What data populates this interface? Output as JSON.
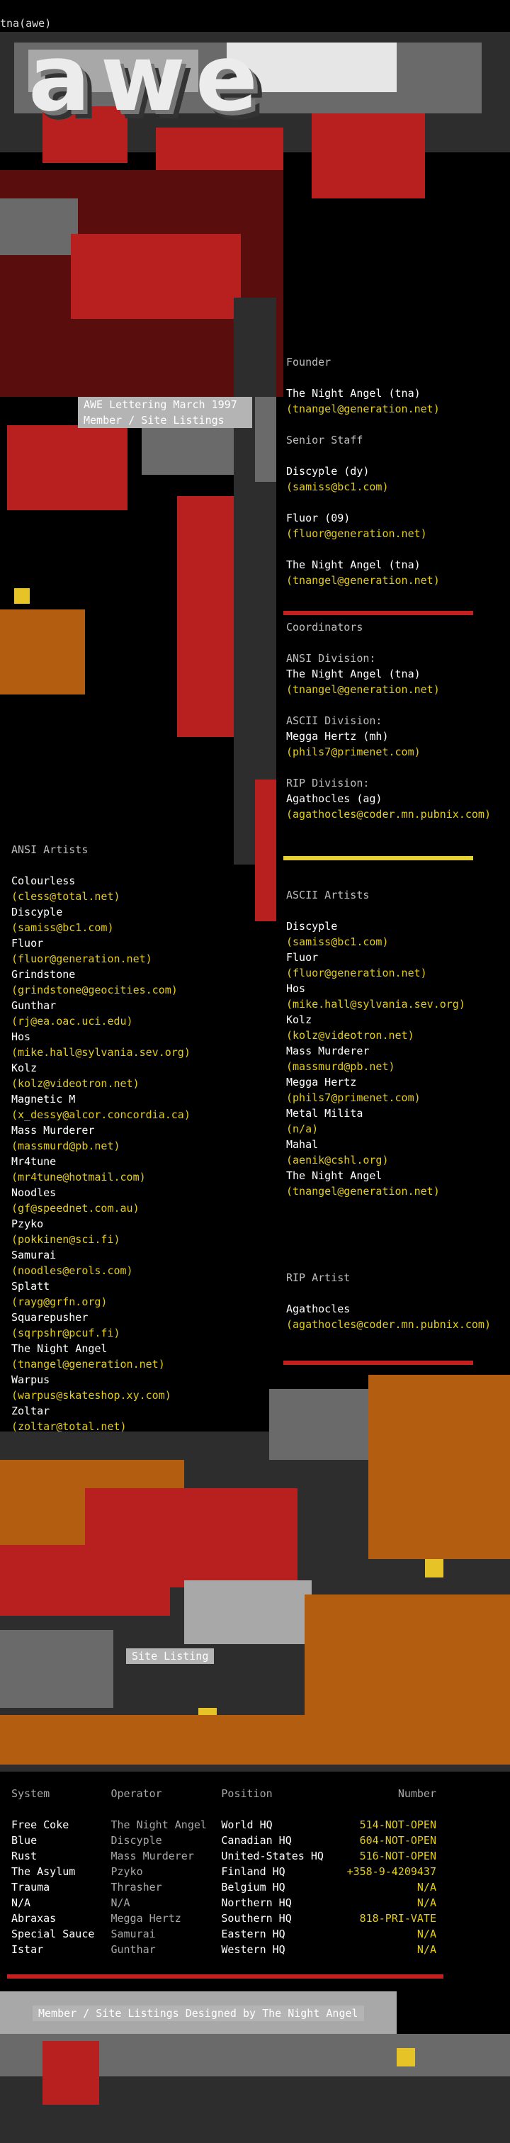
{
  "title_tag": "tna(awe)",
  "logo_text": "awe",
  "header_box": {
    "line1": "AWE Lettering March 1997",
    "line2": "Member / Site Listings"
  },
  "founder": {
    "heading": "Founder",
    "name": "The Night Angel (tna)",
    "email": "(tnangel@generation.net)"
  },
  "senior_staff": {
    "heading": "Senior Staff",
    "members": [
      {
        "name": "Discyple (dy)",
        "email": "(samiss@bc1.com)"
      },
      {
        "name": "Fluor (09)",
        "email": "(fluor@generation.net)"
      },
      {
        "name": "The Night Angel (tna)",
        "email": "(tnangel@generation.net)"
      }
    ]
  },
  "coordinators": {
    "heading": "Coordinators",
    "divisions": [
      {
        "division": "ANSI Division:",
        "name": "The Night Angel (tna)",
        "email": "(tnangel@generation.net)"
      },
      {
        "division": "ASCII Division:",
        "name": "Megga Hertz (mh)",
        "email": "(phils7@primenet.com)"
      },
      {
        "division": "RIP Division:",
        "name": "Agathocles (ag)",
        "email": "(agathocles@coder.mn.pubnix.com)"
      }
    ]
  },
  "ansi_artists": {
    "heading": "ANSI Artists",
    "members": [
      {
        "name": "Colourless",
        "email": "(cless@total.net)"
      },
      {
        "name": "Discyple",
        "email": "(samiss@bc1.com)"
      },
      {
        "name": "Fluor",
        "email": "(fluor@generation.net)"
      },
      {
        "name": "Grindstone",
        "email": "(grindstone@geocities.com)"
      },
      {
        "name": "Gunthar",
        "email": "(rj@ea.oac.uci.edu)"
      },
      {
        "name": "Hos",
        "email": "(mike.hall@sylvania.sev.org)"
      },
      {
        "name": "Kolz",
        "email": "(kolz@videotron.net)"
      },
      {
        "name": "Magnetic M",
        "email": "(x_dessy@alcor.concordia.ca)"
      },
      {
        "name": "Mass Murderer",
        "email": "(massmurd@pb.net)"
      },
      {
        "name": "Mr4tune",
        "email": "(mr4tune@hotmail.com)"
      },
      {
        "name": "Noodles",
        "email": "(gf@speednet.com.au)"
      },
      {
        "name": "Pzyko",
        "email": "(pokkinen@sci.fi)"
      },
      {
        "name": "Samurai",
        "email": "(noodles@erols.com)"
      },
      {
        "name": "Splatt",
        "email": "(rayg@grfn.org)"
      },
      {
        "name": "Squarepusher",
        "email": "(sqrpshr@pcuf.fi)"
      },
      {
        "name": "The Night Angel",
        "email": "(tnangel@generation.net)"
      },
      {
        "name": "Warpus",
        "email": "(warpus@skateshop.xy.com)"
      },
      {
        "name": "Zoltar",
        "email": "(zoltar@total.net)"
      }
    ]
  },
  "ascii_artists": {
    "heading": "ASCII Artists",
    "members": [
      {
        "name": "Discyple",
        "email": "(samiss@bc1.com)"
      },
      {
        "name": "Fluor",
        "email": "(fluor@generation.net)"
      },
      {
        "name": "Hos",
        "email": "(mike.hall@sylvania.sev.org)"
      },
      {
        "name": "Kolz",
        "email": "(kolz@videotron.net)"
      },
      {
        "name": "Mass Murderer",
        "email": "(massmurd@pb.net)"
      },
      {
        "name": "Megga Hertz",
        "email": "(phils7@primenet.com)"
      },
      {
        "name": "Metal Milita",
        "email": "(n/a)"
      },
      {
        "name": "Mahal",
        "email": "(aenik@cshl.org)"
      },
      {
        "name": "The Night Angel",
        "email": "(tnangel@generation.net)"
      }
    ]
  },
  "rip_artist": {
    "heading": "RIP Artist",
    "name": "Agathocles",
    "email": "(agathocles@coder.mn.pubnix.com)"
  },
  "site_listing": {
    "heading": "Site Listing",
    "columns": [
      "System",
      "Operator",
      "Position",
      "Number"
    ],
    "rows": [
      [
        "Free Coke",
        "The Night Angel",
        "World HQ",
        "514-NOT-OPEN"
      ],
      [
        "Blue",
        "Discyple",
        "Canadian HQ",
        "604-NOT-OPEN"
      ],
      [
        "Rust",
        "Mass Murderer",
        "United-States HQ",
        "516-NOT-OPEN"
      ],
      [
        "The Asylum",
        "Pzyko",
        "Finland HQ",
        "+358-9-4209437"
      ],
      [
        "Trauma",
        "Thrasher",
        "Belgium HQ",
        "N/A"
      ],
      [
        "N/A",
        "N/A",
        "Northern HQ",
        "N/A"
      ],
      [
        "Abraxas",
        "Megga Hertz",
        "Southern HQ",
        "818-PRI-VATE"
      ],
      [
        "Special Sauce",
        "Samurai",
        "Eastern HQ",
        "N/A"
      ],
      [
        "Istar",
        "Gunthar",
        "Western HQ",
        "N/A"
      ]
    ]
  },
  "footer_text": "Member / Site Listings Designed by The Night Angel"
}
